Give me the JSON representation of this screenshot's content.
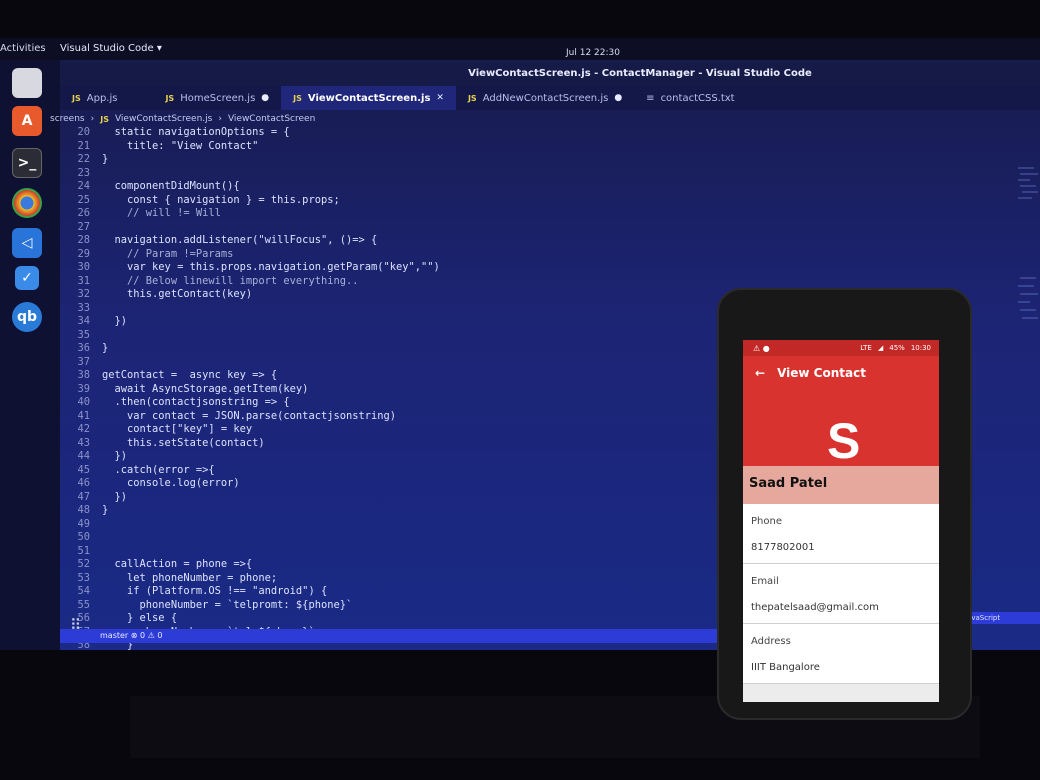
{
  "topbar": {
    "activities": "Activities",
    "app_menu": "Visual Studio Code ▾",
    "clock": "Jul 12  22:30"
  },
  "window": {
    "title": "ViewContactScreen.js - ContactManager - Visual Studio Code"
  },
  "tabs": [
    {
      "label": "App.js",
      "modified": false,
      "active": false
    },
    {
      "label": "HomeScreen.js",
      "modified": true,
      "active": false
    },
    {
      "label": "ViewContactScreen.js",
      "modified": false,
      "active": true
    },
    {
      "label": "AddNewContactScreen.js",
      "modified": true,
      "active": false
    },
    {
      "label": "contactCSS.txt",
      "modified": false,
      "active": false
    }
  ],
  "breadcrumb": {
    "folder": "screens",
    "file": "ViewContactScreen.js",
    "symbol": "ViewContactScreen"
  },
  "code_lines": [
    {
      "n": "20",
      "t": "  static navigationOptions = {"
    },
    {
      "n": "21",
      "t": "    title: \"View Contact\""
    },
    {
      "n": "22",
      "t": "}"
    },
    {
      "n": "23",
      "t": ""
    },
    {
      "n": "24",
      "t": "  componentDidMount(){"
    },
    {
      "n": "25",
      "t": "    const { navigation } = this.props;"
    },
    {
      "n": "26",
      "t": "    // will != Will"
    },
    {
      "n": "27",
      "t": ""
    },
    {
      "n": "28",
      "t": "  navigation.addListener(\"willFocus\", ()=> {"
    },
    {
      "n": "29",
      "t": "    // Param !=Params"
    },
    {
      "n": "30",
      "t": "    var key = this.props.navigation.getParam(\"key\",\"\")"
    },
    {
      "n": "31",
      "t": "    // Below linewill import everything.."
    },
    {
      "n": "32",
      "t": "    this.getContact(key)"
    },
    {
      "n": "33",
      "t": ""
    },
    {
      "n": "34",
      "t": "  })"
    },
    {
      "n": "35",
      "t": ""
    },
    {
      "n": "36",
      "t": "}"
    },
    {
      "n": "37",
      "t": ""
    },
    {
      "n": "38",
      "t": "getContact =  async key => {"
    },
    {
      "n": "39",
      "t": "  await AsyncStorage.getItem(key)"
    },
    {
      "n": "40",
      "t": "  .then(contactjsonstring => {"
    },
    {
      "n": "41",
      "t": "    var contact = JSON.parse(contactjsonstring)"
    },
    {
      "n": "42",
      "t": "    contact[\"key\"] = key"
    },
    {
      "n": "43",
      "t": "    this.setState(contact)"
    },
    {
      "n": "44",
      "t": "  })"
    },
    {
      "n": "45",
      "t": "  .catch(error =>{"
    },
    {
      "n": "46",
      "t": "    console.log(error)"
    },
    {
      "n": "47",
      "t": "  })"
    },
    {
      "n": "48",
      "t": "}"
    },
    {
      "n": "49",
      "t": ""
    },
    {
      "n": "50",
      "t": ""
    },
    {
      "n": "51",
      "t": ""
    },
    {
      "n": "52",
      "t": "  callAction = phone =>{"
    },
    {
      "n": "53",
      "t": "    let phoneNumber = phone;"
    },
    {
      "n": "54",
      "t": "    if (Platform.OS !== \"android\") {"
    },
    {
      "n": "55",
      "t": "      phoneNumber = `telpromt: ${phone}`"
    },
    {
      "n": "56",
      "t": "    } else {"
    },
    {
      "n": "57",
      "t": "      phoneNumber = `tel:${phone}`"
    },
    {
      "n": "58",
      "t": "    }"
    },
    {
      "n": "59",
      "t": ""
    }
  ],
  "statusbar": {
    "left": "master   ⊗ 0 ⚠ 0",
    "right": "JavaScript"
  },
  "phone": {
    "status_time": "10:30",
    "status_battery": "45%",
    "status_net": "LTE",
    "app_title": "View Contact",
    "avatar_letter": "S",
    "name": "Saad Patel",
    "fields": [
      {
        "label": "Phone",
        "value": "8177802001"
      },
      {
        "label": "Email",
        "value": "thepatelsaad@gmail.com"
      },
      {
        "label": "Address",
        "value": "IIIT Bangalore"
      }
    ]
  },
  "colors": {
    "editor_bg": "#1c2474",
    "app_red": "#d9332f",
    "name_band": "#e6a79c",
    "status_blue": "#2d3cd6"
  }
}
